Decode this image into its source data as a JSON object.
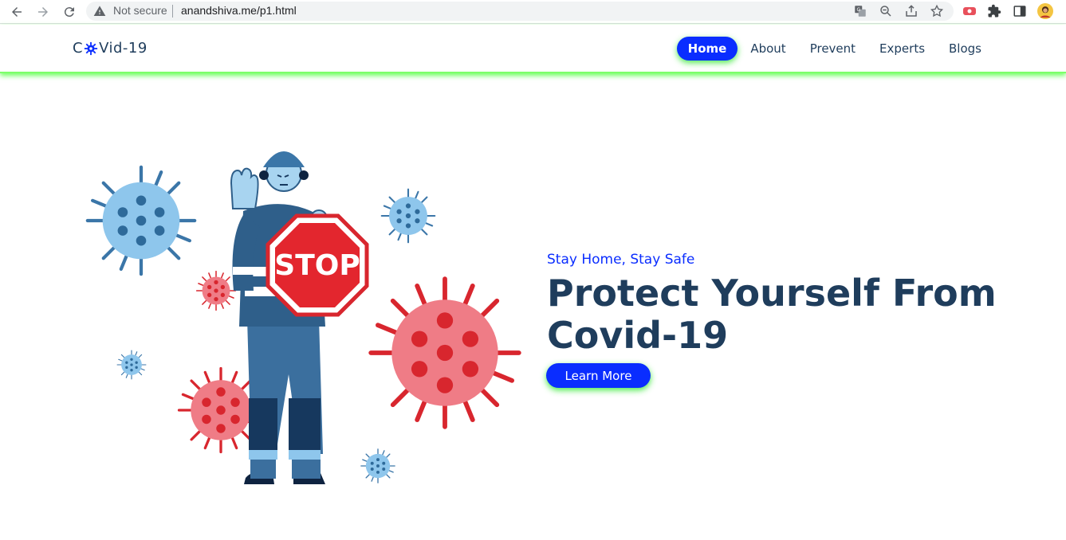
{
  "browser": {
    "security_label": "Not secure",
    "url": "anandshiva.me/p1.html",
    "icons": [
      "back-arrow-icon",
      "forward-arrow-icon",
      "reload-icon",
      "warning-icon",
      "translate-icon",
      "zoom-icon",
      "share-icon",
      "bookmark-star-icon",
      "extension-badge-icon",
      "puzzle-icon",
      "sidepanel-icon",
      "profile-avatar"
    ]
  },
  "site": {
    "brand_prefix": "C",
    "brand_suffix": "Vid-19",
    "nav": [
      {
        "label": "Home",
        "active": true
      },
      {
        "label": "About",
        "active": false
      },
      {
        "label": "Prevent",
        "active": false
      },
      {
        "label": "Experts",
        "active": false
      },
      {
        "label": "Blogs",
        "active": false
      }
    ]
  },
  "hero": {
    "tagline": "Stay Home, Stay Safe",
    "headline_line1": "Protect Yourself From",
    "headline_line2": "Covid-19",
    "cta_label": "Learn More",
    "illustration_sign_text": "STOP"
  },
  "colors": {
    "accent_blue": "#0a2dff",
    "heading_navy": "#1f3d5c",
    "glow_green": "#56ff3a",
    "virus_red": "#e3262e",
    "virus_blue": "#8ac4ea"
  }
}
